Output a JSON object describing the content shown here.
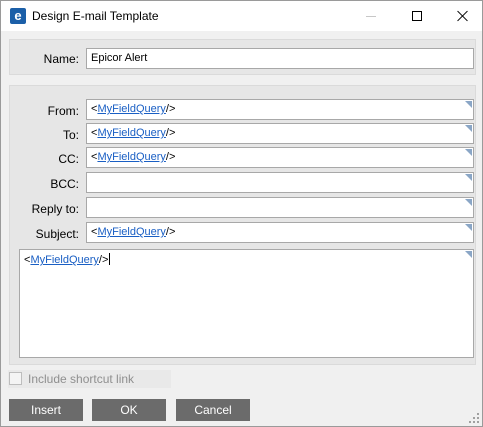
{
  "window": {
    "title": "Design E-mail Template",
    "app_icon_letter": "e",
    "accent_color": "#1b5fa8"
  },
  "name": {
    "label": "Name:",
    "value": "Epicor Alert"
  },
  "fields": [
    {
      "key": "from",
      "label": "From:",
      "prefix": "<",
      "token": "MyFieldQuery",
      "suffix": "/>"
    },
    {
      "key": "to",
      "label": "To:",
      "prefix": "<",
      "token": "MyFieldQuery",
      "suffix": "/>"
    },
    {
      "key": "cc",
      "label": "CC:",
      "prefix": "<",
      "token": "MyFieldQuery",
      "suffix": "/>"
    },
    {
      "key": "bcc",
      "label": "BCC:",
      "prefix": "",
      "token": "",
      "suffix": ""
    },
    {
      "key": "reply_to",
      "label": "Reply to:",
      "prefix": "",
      "token": "",
      "suffix": ""
    },
    {
      "key": "subject",
      "label": "Subject:",
      "prefix": "<",
      "token": "MyFieldQuery",
      "suffix": "/>"
    }
  ],
  "body": {
    "prefix": "<",
    "token": "MyFieldQuery",
    "suffix": "/>"
  },
  "checkbox": {
    "label": "Include shortcut link",
    "checked": false,
    "disabled": true
  },
  "buttons": {
    "insert": "Insert",
    "ok": "OK",
    "cancel": "Cancel"
  }
}
